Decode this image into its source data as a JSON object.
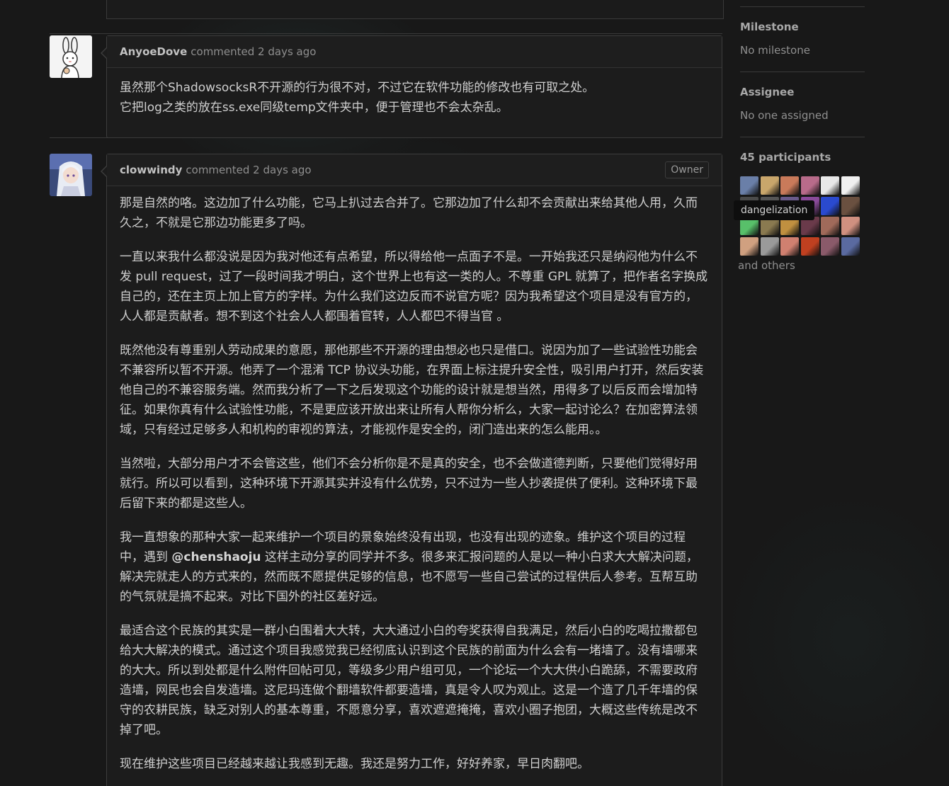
{
  "comments": [
    {
      "author": "AnyoeDove",
      "timestamp": "commented 2 days ago",
      "paragraphs": [
        "虽然那个ShadowsocksR不开源的行为很不对，不过它在软件功能的修改也有可取之处。\n它把log之类的放在ss.exe同级temp文件夹中，便于管理也不会太杂乱。"
      ]
    },
    {
      "author": "clowwindy",
      "timestamp": "commented 2 days ago",
      "badge": "Owner",
      "paragraphs": [
        "那是自然的咯。这边加了什么功能，它马上扒过去合并了。它那边加了什么却不会贡献出来给其他人用，久而久之，不就是它那边功能更多了吗。",
        "一直以来我什么都没说是因为我对他还有点希望，所以得给他一点面子不是。一开始我还只是纳闷他为什么不发 pull request，过了一段时间我才明白，这个世界上也有这一类的人。不尊重 GPL 就算了，把作者名字换成自己的，还在主页上加上官方的字样。为什么我们这边反而不说官方呢？因为我希望这个项目是没有官方的，人人都是贡献者。想不到这个社会人人都围着官转，人人都巴不得当官 。",
        "既然他没有尊重别人劳动成果的意愿，那他那些不开源的理由想必也只是借口。说因为加了一些试验性功能会不兼容所以暂不开源。他弄了一个混淆 TCP 协议头功能，在界面上标注提升安全性，吸引用户打开，然后安装他自己的不兼容服务端。然而我分析了一下之后发现这个功能的设计就是想当然，用得多了以后反而会增加特征。如果你真有什么试验性功能，不是更应该开放出来让所有人帮你分析么，大家一起讨论么？在加密算法领域，只有经过足够多人和机构的审视的算法，才能视作是安全的，闭门造出来的怎么能用。。",
        "当然啦，大部分用户才不会管这些，他们不会分析你是不是真的安全，也不会做道德判断，只要他们觉得好用就行。所以可以看到，这种环境下开源其实并没有什么优势，只不过为一些人抄袭提供了便利。这种环境下最后留下来的都是这些人。",
        {
          "before": "我一直想象的那种大家一起来维护一个项目的景象始终没有出现，也没有出现的迹象。维护这个项目的过程中，遇到 ",
          "mention": "@chenshaoju",
          "after": " 这样主动分享的同学并不多。很多来汇报问题的人是以一种小白求大大解决问题，解决完就走人的方式来的，然而既不愿提供足够的信息，也不愿写一些自己尝试的过程供后人参考。互帮互助的气氛就是搞不起来。对比下国外的社区差好远。"
        },
        "最适合这个民族的其实是一群小白围着大大转，大大通过小白的夸奖获得自我满足，然后小白的吃喝拉撒都包给大大解决的模式。通过这个项目我感觉我已经彻底认识到这个民族的前面为什么会有一堵墙了。没有墙哪来的大大。所以到处都是什么附件回帖可见，等级多少用户组可见，一个论坛一个大大供小白跪舔，不需要政府造墙，网民也会自发造墙。这尼玛连做个翻墙软件都要造墙，真是令人叹为观止。这是一个造了几千年墙的保守的农耕民族，缺乏对别人的基本尊重，不愿意分享，喜欢遮遮掩掩，喜欢小圈子抱团，大概这些传统是改不掉了吧。",
        "现在维护这些项目已经越来越让我感到无趣。我还是努力工作，好好养家，早日肉翻吧。"
      ]
    }
  ],
  "sidebar": {
    "milestone_title": "Milestone",
    "milestone_value": "No milestone",
    "assignee_title": "Assignee",
    "assignee_value": "No one assigned",
    "participants_title": "45 participants",
    "tooltip": "dangelization",
    "others": "and others"
  },
  "participant_colors": [
    [
      "#6a7fa8",
      "#c9a66b",
      "#c97a5a",
      "#b86b8a",
      "#e8e8e8",
      "#f0f0f0"
    ],
    [
      "#4a4a4a",
      "#555555",
      "#6a5a8a",
      "#8a4a9a",
      "#2a4acf",
      "#6a5040"
    ],
    [
      "#58c06a",
      "#8a7a50",
      "#c09040",
      "#6a3a4a",
      "#a06a5a",
      "#d09080"
    ],
    [
      "#d0a080",
      "#9a9a9a",
      "#d08070",
      "#c04020",
      "#8a5a6a",
      "#5a6aa0"
    ]
  ]
}
